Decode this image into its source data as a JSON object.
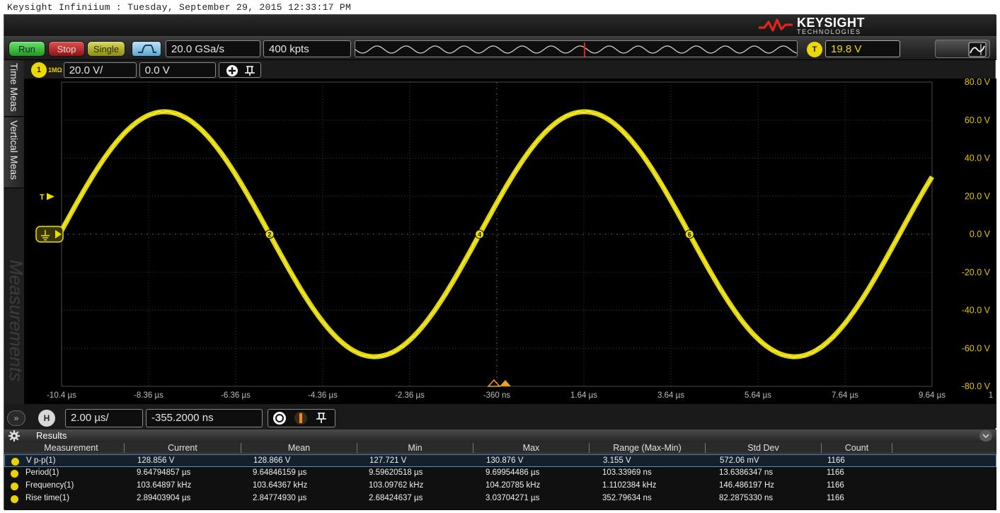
{
  "title_bar": "Keysight Infiniium : Tuesday, September 29, 2015 12:33:17 PM",
  "brand": {
    "name": "KEYSIGHT",
    "sub": "TECHNOLOGIES",
    "color": "#e1251b"
  },
  "toolbar": {
    "run_label": "Run",
    "stop_label": "Stop",
    "single_label": "Single",
    "sample_rate": "20.0 GSa/s",
    "memory_depth": "400 kpts",
    "trigger_badge": "T",
    "trigger_level": "19.8 V"
  },
  "side_tabs": {
    "time": "Time Meas",
    "vertical": "Vertical Meas",
    "measurements": "Measurements"
  },
  "channel": {
    "badge": "1",
    "tag": "1MΩ",
    "scale": "20.0 V/",
    "offset": "0.0 V",
    "color": "#ece000"
  },
  "horizontal": {
    "badge": "H",
    "scale": "2.00 µs/",
    "position": "-355.2000 ns"
  },
  "chart_data": {
    "type": "line",
    "x_ticks": [
      "-10.4 µs",
      "-8.36 µs",
      "-6.36 µs",
      "-4.36 µs",
      "-2.36 µs",
      "-360 ns",
      "1.64 µs",
      "3.64 µs",
      "5.64 µs",
      "7.64 µs",
      "9.64 µs"
    ],
    "y_ticks": [
      "80.0 V",
      "60.0 V",
      "40.0 V",
      "20.0 V",
      "0.0 V",
      "-20.0 V",
      "-40.0 V",
      "-60.0 V",
      "-80.0 V"
    ],
    "xlim_us": [
      -10.355,
      9.645
    ],
    "ylim_v": [
      -80,
      80
    ],
    "extra_label": "1",
    "waveform": {
      "amplitude_v": 64.4,
      "period_us": 9.648,
      "zero_cross_rising_us": -10.4,
      "noise_band_v": 2.5
    },
    "markers": [
      "2",
      "4",
      "6"
    ],
    "trigger_label": "T",
    "grid": true
  },
  "results": {
    "title": "Results",
    "columns": [
      "Measurement",
      "Current",
      "Mean",
      "Min",
      "Max",
      "Range (Max-Min)",
      "Std Dev",
      "Count"
    ],
    "rows": [
      [
        "V p-p(1)",
        "128.856 V",
        "128.866 V",
        "127.721 V",
        "130.876 V",
        "3.155 V",
        "572.06 mV",
        "1166"
      ],
      [
        "Period(1)",
        "9.64794857 µs",
        "9.64846159 µs",
        "9.59620518 µs",
        "9.69954486 µs",
        "103.33969 ns",
        "13.6386347 ns",
        "1166"
      ],
      [
        "Frequency(1)",
        "103.64897 kHz",
        "103.64367 kHz",
        "103.09762 kHz",
        "104.20785 kHz",
        "1.1102384 kHz",
        "146.486197 Hz",
        "1166"
      ],
      [
        "Rise time(1)",
        "2.89403904 µs",
        "2.84774930 µs",
        "2.68424637 µs",
        "3.03704271 µs",
        "352.79634 ns",
        "82.2875330 ns",
        "1166"
      ]
    ]
  }
}
